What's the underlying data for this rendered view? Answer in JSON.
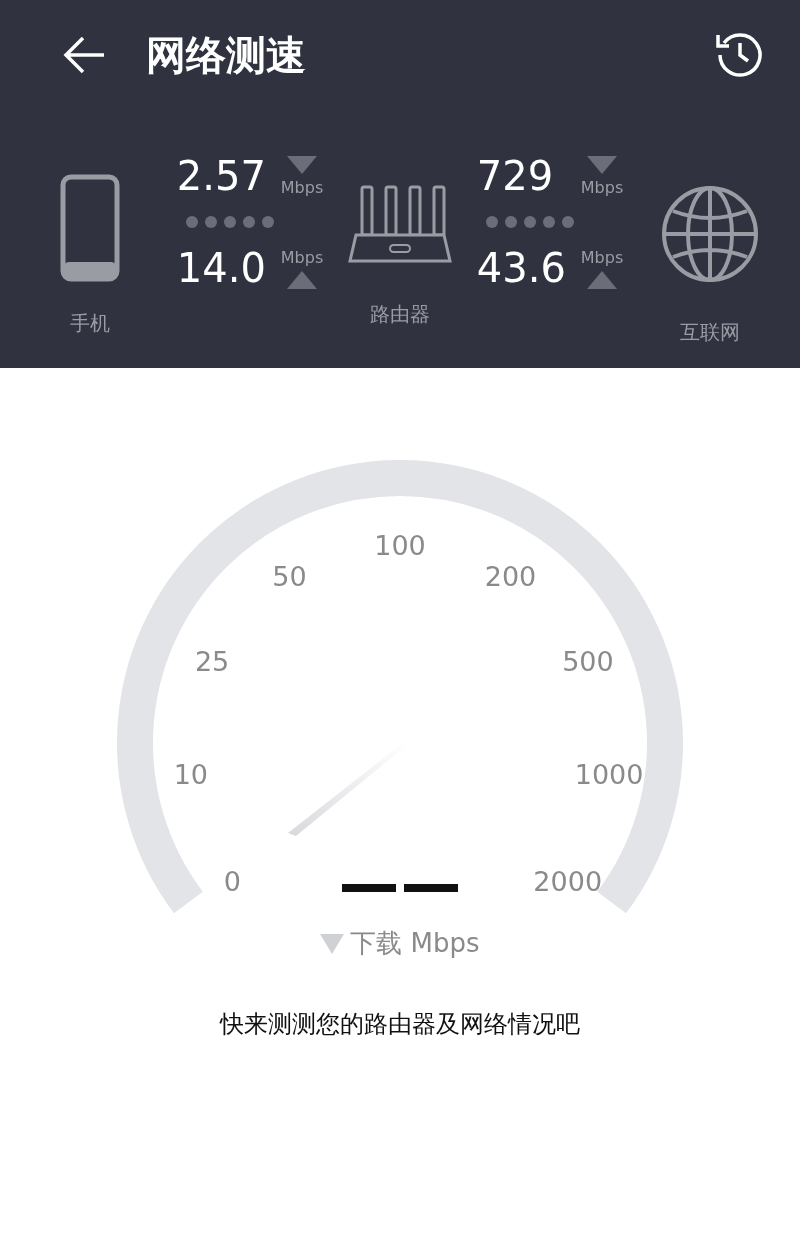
{
  "header": {
    "title": "网络测速"
  },
  "nodes": [
    {
      "kind": "phone",
      "label": "手机"
    },
    {
      "kind": "router",
      "label": "路由器"
    },
    {
      "kind": "globe",
      "label": "互联网"
    }
  ],
  "links": [
    {
      "download": {
        "value": "2.57",
        "unit": "Mbps"
      },
      "upload": {
        "value": "14.0",
        "unit": "Mbps"
      }
    },
    {
      "download": {
        "value": "729",
        "unit": "Mbps"
      },
      "upload": {
        "value": "43.6",
        "unit": "Mbps"
      }
    }
  ],
  "gauge": {
    "ticks": [
      "0",
      "10",
      "25",
      "50",
      "100",
      "200",
      "500",
      "1000",
      "2000"
    ],
    "reading_label": "下载 Mbps"
  },
  "message": "快来测测您的路由器及网络情况吧"
}
